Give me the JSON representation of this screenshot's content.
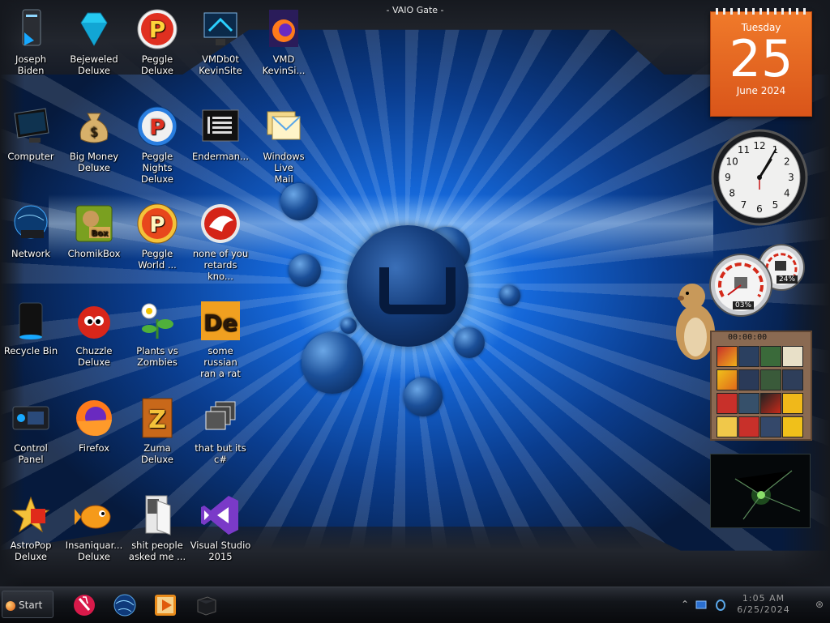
{
  "window": {
    "title": "- VAIO Gate -"
  },
  "desktop_icons": [
    {
      "label": "Joseph\nBiden",
      "icon": "pc-tower-icon"
    },
    {
      "label": "Bejeweled\nDeluxe",
      "icon": "diamond-gem-icon"
    },
    {
      "label": "Peggle\nDeluxe",
      "icon": "peggle-p-icon"
    },
    {
      "label": "VMDb0t\nKevinSite",
      "icon": "vm-monitor-icon"
    },
    {
      "label": "VMD\nKevinSi...",
      "icon": "firefox-icon"
    },
    {
      "label": "Computer",
      "icon": "monitor-icon"
    },
    {
      "label": "Big Money\nDeluxe",
      "icon": "money-bag-icon"
    },
    {
      "label": "Peggle\nNights Deluxe",
      "icon": "peggle-nights-icon"
    },
    {
      "label": "Enderman...",
      "icon": "terminal-icon"
    },
    {
      "label": "Windows Live\nMail",
      "icon": "envelope-icon"
    },
    {
      "label": "Network",
      "icon": "network-globe-icon"
    },
    {
      "label": "ChomikBox",
      "icon": "hamster-box-icon"
    },
    {
      "label": "Peggle\nWorld ...",
      "icon": "peggle-world-icon"
    },
    {
      "label": "none of you\nretards kno...",
      "icon": "red-creature-icon"
    },
    {
      "label": "Recycle Bin",
      "icon": "recycle-bin-icon"
    },
    {
      "label": "Chuzzle\nDeluxe",
      "icon": "chuzzle-icon"
    },
    {
      "label": "Plants vs\nZombies",
      "icon": "flower-icon"
    },
    {
      "label": "some russian\nran a rat",
      "icon": "de-logo-icon"
    },
    {
      "label": "Control Panel",
      "icon": "control-panel-icon"
    },
    {
      "label": "Firefox",
      "icon": "firefox-icon"
    },
    {
      "label": "Zuma Deluxe",
      "icon": "zuma-icon"
    },
    {
      "label": "that but its\nc#",
      "icon": "stacked-windows-icon"
    },
    {
      "label": "AstroPop\nDeluxe",
      "icon": "astropop-icon"
    },
    {
      "label": "Insaniquar...\nDeluxe",
      "icon": "goldfish-icon"
    },
    {
      "label": "shit people\nasked me ...",
      "icon": "folder-icon"
    },
    {
      "label": "Visual Studio\n2015",
      "icon": "visual-studio-icon"
    }
  ],
  "calendar": {
    "weekday": "Tuesday",
    "day": "25",
    "month_year": "June 2024"
  },
  "clock_gadget": {
    "numerals": [
      "12",
      "1",
      "2",
      "3",
      "4",
      "5",
      "6",
      "7",
      "8",
      "9",
      "10",
      "11"
    ],
    "hour": 1,
    "minute": 5
  },
  "cpu_meter": {
    "cpu_label": "03%",
    "ram_label": "24%"
  },
  "puzzle_gadget": {
    "timer": "00:00:00"
  },
  "taskbar": {
    "start_label": "Start",
    "pinned": [
      "pen-paint-icon",
      "globe-icon",
      "media-player-icon",
      "cube-icon"
    ],
    "tray": [
      "chevron-up-icon",
      "monitor-tray-icon",
      "shield-tray-icon"
    ],
    "time": "1:05 AM",
    "date": "6/25/2024"
  },
  "colors": {
    "accent": "#e8631c",
    "wallpaper": "#1567d8",
    "frame": "#1a1d23"
  }
}
